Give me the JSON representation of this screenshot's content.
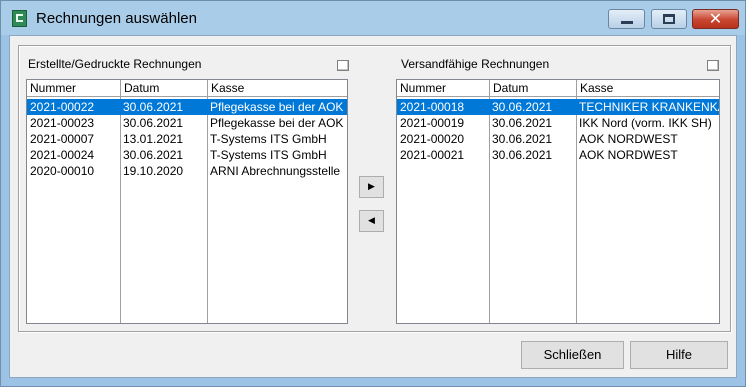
{
  "window": {
    "title": "Rechnungen auswählen",
    "controls": [
      "minimize-icon",
      "maximize-icon",
      "close-icon"
    ],
    "close_glyph": "✕",
    "close_color": "#c8452f"
  },
  "left_panel": {
    "label": "Erstellte/Gedruckte Rechnungen",
    "columns": [
      "Nummer",
      "Datum",
      "Kasse"
    ],
    "rows": [
      {
        "nummer": "2021-00022",
        "datum": "30.06.2021",
        "kasse": "Pflegekasse bei der AOK",
        "selected": true
      },
      {
        "nummer": "2021-00023",
        "datum": "30.06.2021",
        "kasse": "Pflegekasse bei der AOK",
        "selected": false
      },
      {
        "nummer": "2021-00007",
        "datum": "13.01.2021",
        "kasse": "T-Systems ITS GmbH",
        "selected": false
      },
      {
        "nummer": "2021-00024",
        "datum": "30.06.2021",
        "kasse": "T-Systems ITS GmbH",
        "selected": false
      },
      {
        "nummer": "2020-00010",
        "datum": "19.10.2020",
        "kasse": "ARNI Abrechnungsstelle",
        "selected": false
      }
    ]
  },
  "right_panel": {
    "label": "Versandfähige Rechnungen",
    "columns": [
      "Nummer",
      "Datum",
      "Kasse"
    ],
    "rows": [
      {
        "nummer": "2021-00018",
        "datum": "30.06.2021",
        "kasse": "TECHNIKER KRANKENKASSE",
        "selected": true
      },
      {
        "nummer": "2021-00019",
        "datum": "30.06.2021",
        "kasse": "IKK Nord (vorm. IKK SH)",
        "selected": false
      },
      {
        "nummer": "2021-00020",
        "datum": "30.06.2021",
        "kasse": "AOK NORDWEST",
        "selected": false
      },
      {
        "nummer": "2021-00021",
        "datum": "30.06.2021",
        "kasse": "AOK NORDWEST",
        "selected": false
      }
    ]
  },
  "transfer_buttons": {
    "move_right_glyph": "▶",
    "move_left_glyph": "◀"
  },
  "buttons": {
    "close_label": "Schließen",
    "help_label": "Hilfe"
  },
  "colors": {
    "selection": "#0078d7",
    "titlebar": "#a9cde9"
  }
}
